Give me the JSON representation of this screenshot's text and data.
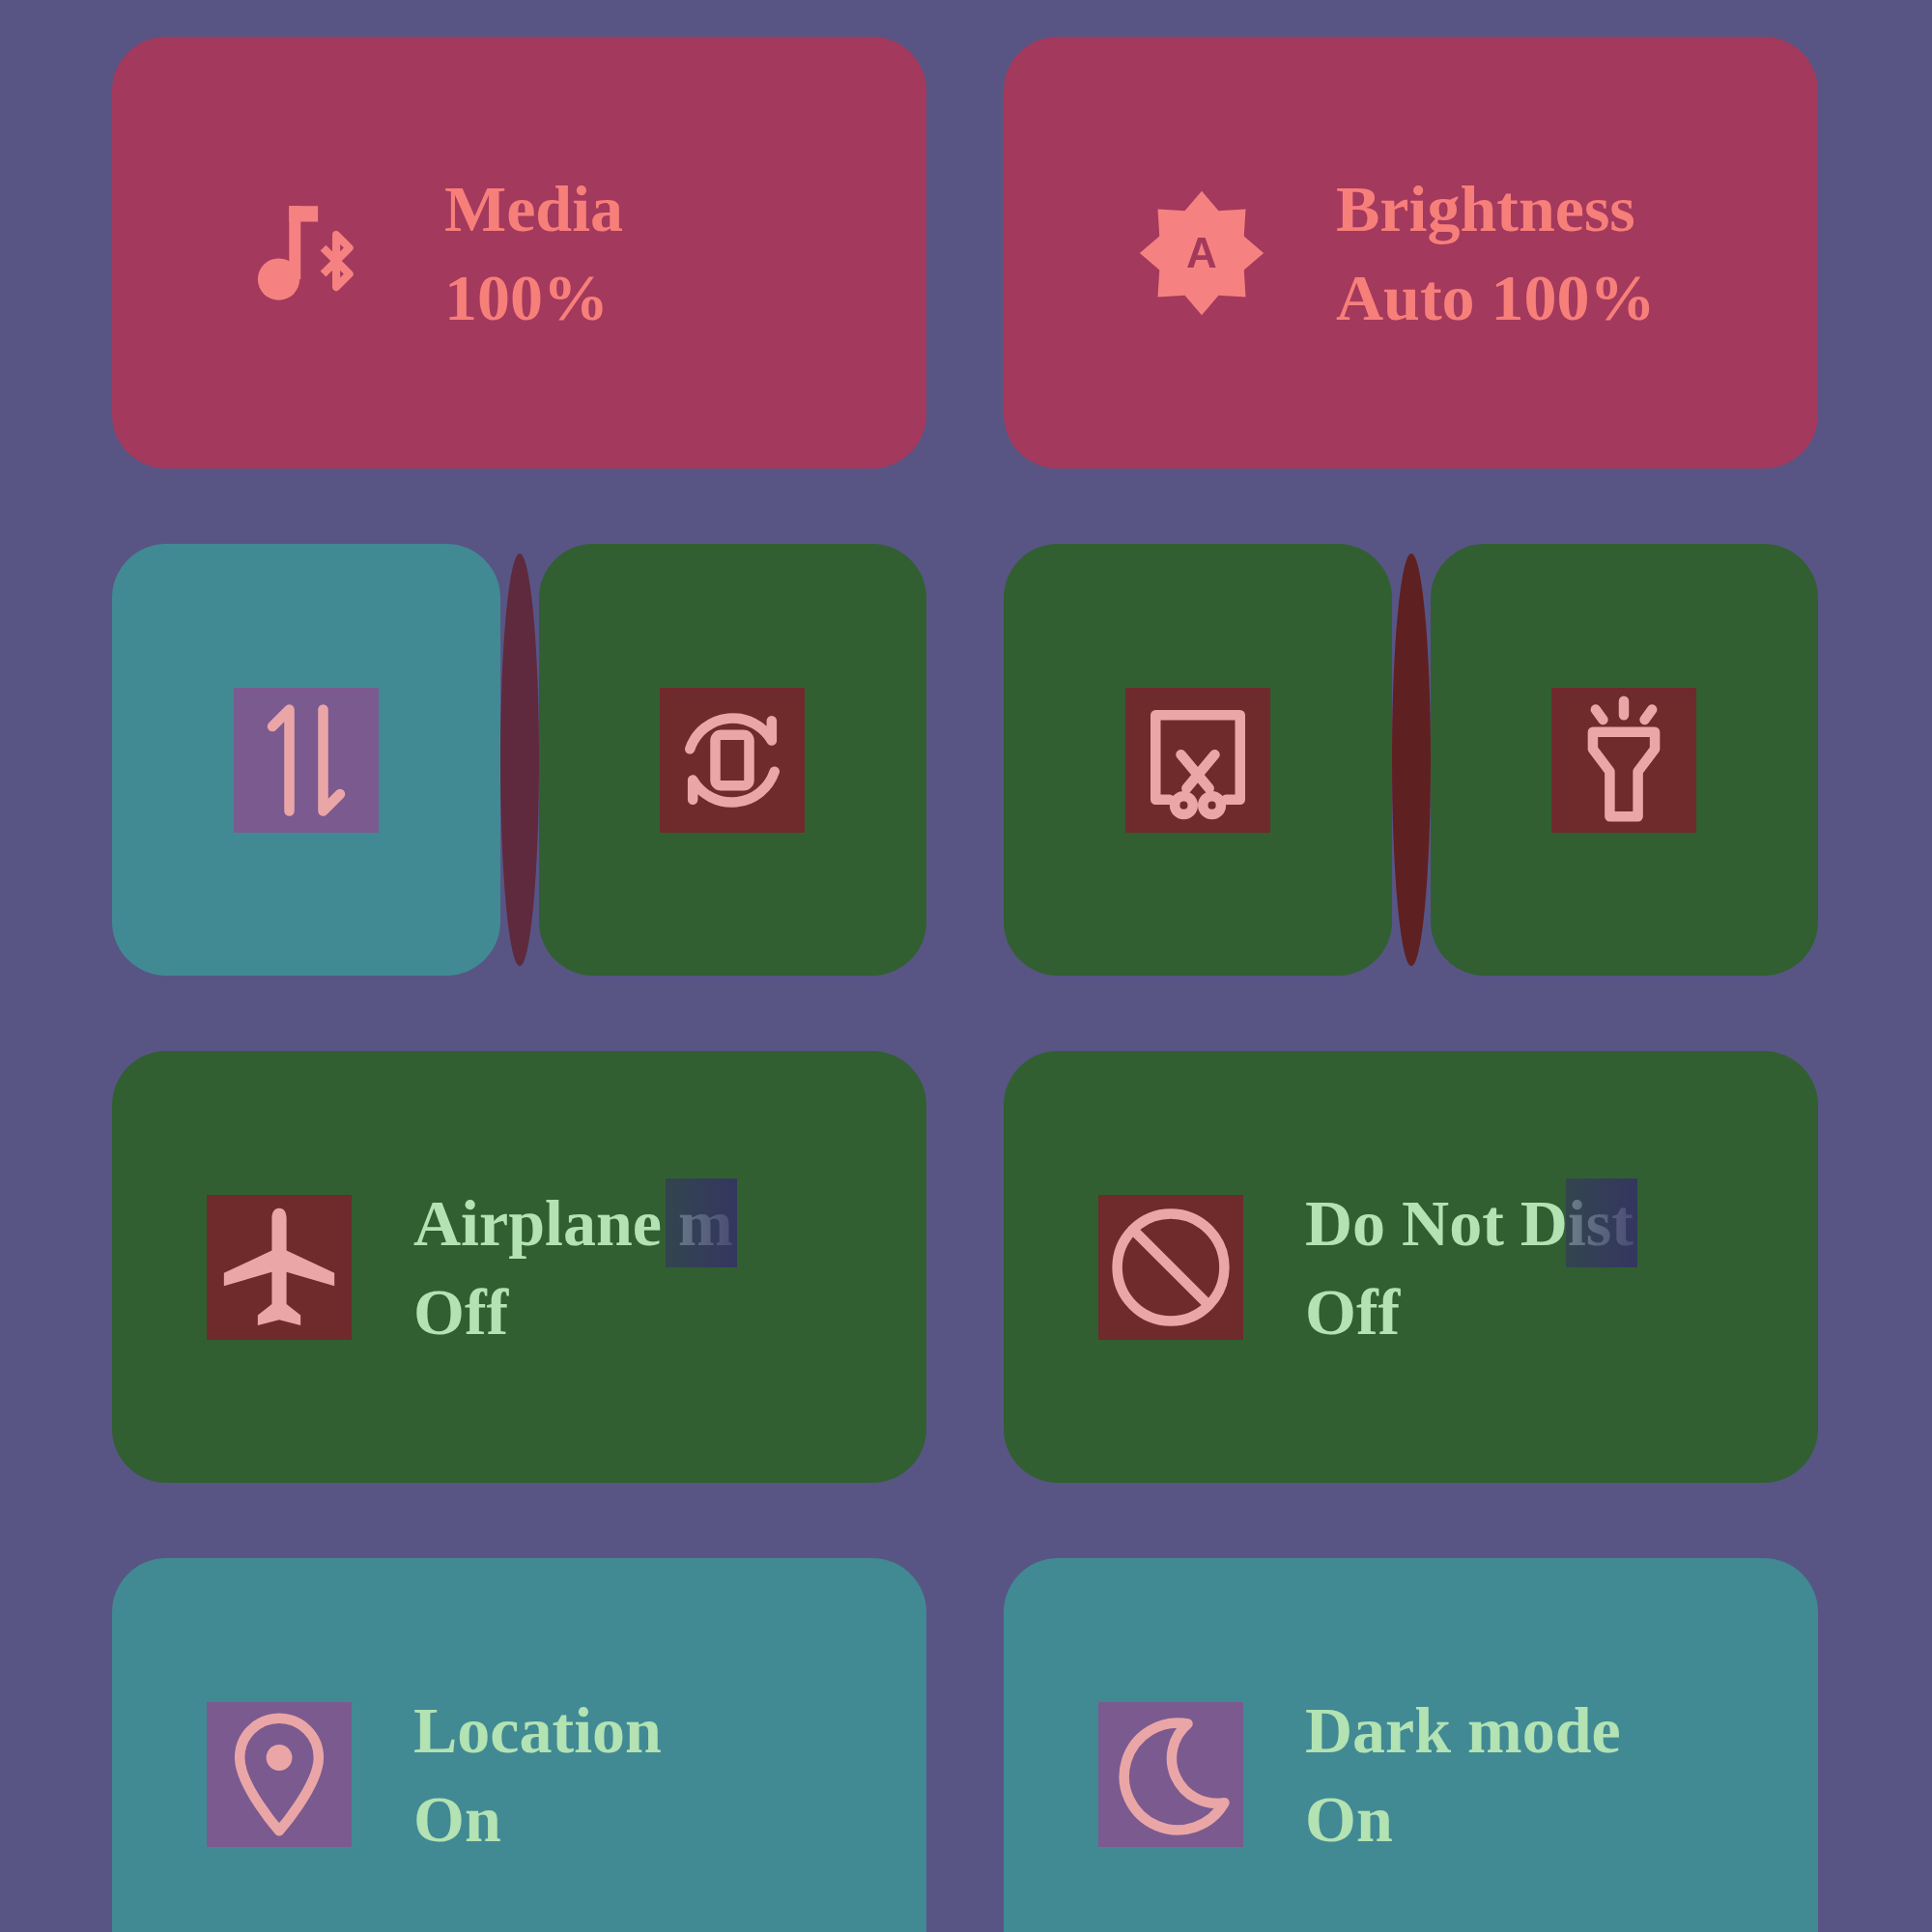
{
  "tiles": [
    {
      "kind": "slider",
      "title": "Media",
      "subtitle": "100%"
    },
    {
      "kind": "slider",
      "title": "Brightness",
      "subtitle": "Auto 100%",
      "badge": "A"
    },
    {
      "kind": "split",
      "halves": [
        {
          "on": true
        },
        {
          "on": false
        }
      ]
    },
    {
      "kind": "split",
      "halves": [
        {
          "on": false
        },
        {
          "on": false
        }
      ]
    },
    {
      "kind": "toggle",
      "title": "Airplane m",
      "subtitle": "Off",
      "on": false,
      "faded": true
    },
    {
      "kind": "toggle",
      "title": "Do Not Dist",
      "subtitle": "Off",
      "on": false,
      "faded": true
    },
    {
      "kind": "toggle",
      "title": "Location",
      "subtitle": "On",
      "on": true,
      "faded": false
    },
    {
      "kind": "toggle",
      "title": "Dark mode",
      "subtitle": "On",
      "on": true,
      "faded": false
    }
  ]
}
